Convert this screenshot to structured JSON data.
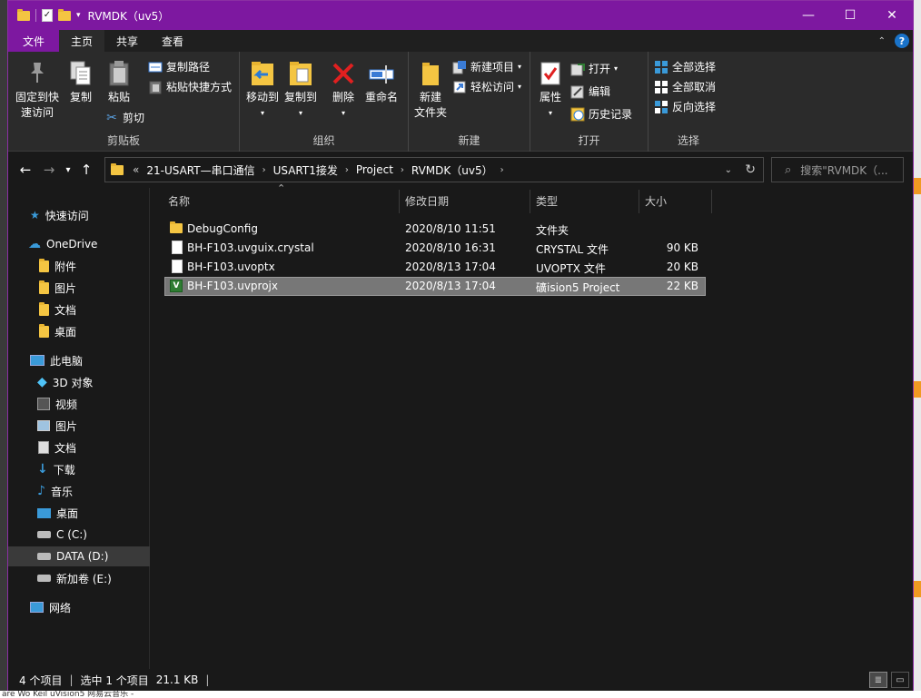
{
  "window": {
    "title": "RVMDK（uv5）",
    "controls": {
      "minimize": "—",
      "maximize": "☐",
      "close": "✕"
    }
  },
  "ribbon_tabs": [
    {
      "label": "文件"
    },
    {
      "label": "主页"
    },
    {
      "label": "共享"
    },
    {
      "label": "查看"
    }
  ],
  "ribbon": {
    "clipboard": {
      "label": "剪贴板",
      "pin": "固定到快\n速访问",
      "pin_l1": "固定到快",
      "pin_l2": "速访问",
      "copy": "复制",
      "paste": "粘贴",
      "copy_path": "复制路径",
      "paste_shortcut": "粘贴快捷方式",
      "cut": "剪切"
    },
    "organize": {
      "label": "组织",
      "move_to": "移动到",
      "copy_to": "复制到",
      "delete": "删除",
      "rename": "重命名"
    },
    "new": {
      "label": "新建",
      "new_folder_l1": "新建",
      "new_folder_l2": "文件夹",
      "new_item": "新建项目",
      "easy_access": "轻松访问"
    },
    "open": {
      "label": "打开",
      "properties": "属性",
      "open": "打开",
      "edit": "编辑",
      "history": "历史记录"
    },
    "select": {
      "label": "选择",
      "select_all": "全部选择",
      "select_none": "全部取消",
      "invert": "反向选择"
    }
  },
  "address": {
    "overflow": "«",
    "crumbs": [
      "21-USART—串口通信",
      "USART1接发",
      "Project",
      "RVMDK（uv5）"
    ]
  },
  "search": {
    "placeholder": "搜索\"RVMDK（..."
  },
  "sidebar": {
    "items": [
      {
        "label": "快速访问"
      },
      {
        "label": "OneDrive"
      },
      {
        "label": "附件"
      },
      {
        "label": "图片"
      },
      {
        "label": "文档"
      },
      {
        "label": "桌面"
      },
      {
        "label": "此电脑"
      },
      {
        "label": "3D 对象"
      },
      {
        "label": "视频"
      },
      {
        "label": "图片"
      },
      {
        "label": "文档"
      },
      {
        "label": "下载"
      },
      {
        "label": "音乐"
      },
      {
        "label": "桌面"
      },
      {
        "label": "C (C:)"
      },
      {
        "label": "DATA (D:)"
      },
      {
        "label": "新加卷 (E:)"
      },
      {
        "label": "网络"
      }
    ]
  },
  "columns": {
    "name": "名称",
    "date": "修改日期",
    "type": "类型",
    "size": "大小"
  },
  "files": [
    {
      "name": "DebugConfig",
      "date": "2020/8/10 11:51",
      "type": "文件夹",
      "size": ""
    },
    {
      "name": "BH-F103.uvguix.crystal",
      "date": "2020/8/10 16:31",
      "type": "CRYSTAL 文件",
      "size": "90 KB"
    },
    {
      "name": "BH-F103.uvoptx",
      "date": "2020/8/13 17:04",
      "type": "UVOPTX 文件",
      "size": "20 KB"
    },
    {
      "name": "BH-F103.uvprojx",
      "date": "2020/8/13 17:04",
      "type": "礦ision5 Project",
      "size": "22 KB"
    }
  ],
  "status": {
    "count": "4 个项目",
    "selected": "选中 1 个项目",
    "sel_size": "21.1 KB"
  },
  "taskbar_text": "are Wo   Keil uVision5   网易云音乐 -",
  "colors": {
    "accent": "#7d18a0",
    "selection": "#777777",
    "folder": "#f4c542"
  }
}
